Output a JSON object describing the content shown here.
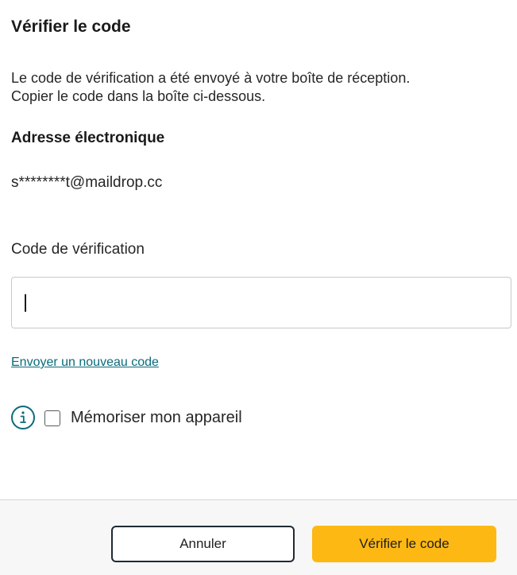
{
  "dialog": {
    "title": "Vérifier le code",
    "description_line1": "Le code de vérification a été envoyé à votre boîte de réception.",
    "description_line2": "Copier le code dans la boîte ci-dessous.",
    "email_label": "Adresse électronique",
    "email_value": "s********t@maildrop.cc",
    "code_label": "Code de vérification",
    "code_value": "",
    "code_placeholder": "",
    "resend_link": "Envoyer un nouveau code",
    "remember_label": "Mémoriser mon appareil",
    "remember_checked": false
  },
  "footer": {
    "cancel_label": "Annuler",
    "verify_label": "Vérifier le code"
  },
  "colors": {
    "accent": "#0b6b7b",
    "primary_button": "#fdb813",
    "cancel_border": "#1f2a33",
    "footer_bg": "#f7f7f7"
  },
  "icons": {
    "info": "info-icon"
  }
}
